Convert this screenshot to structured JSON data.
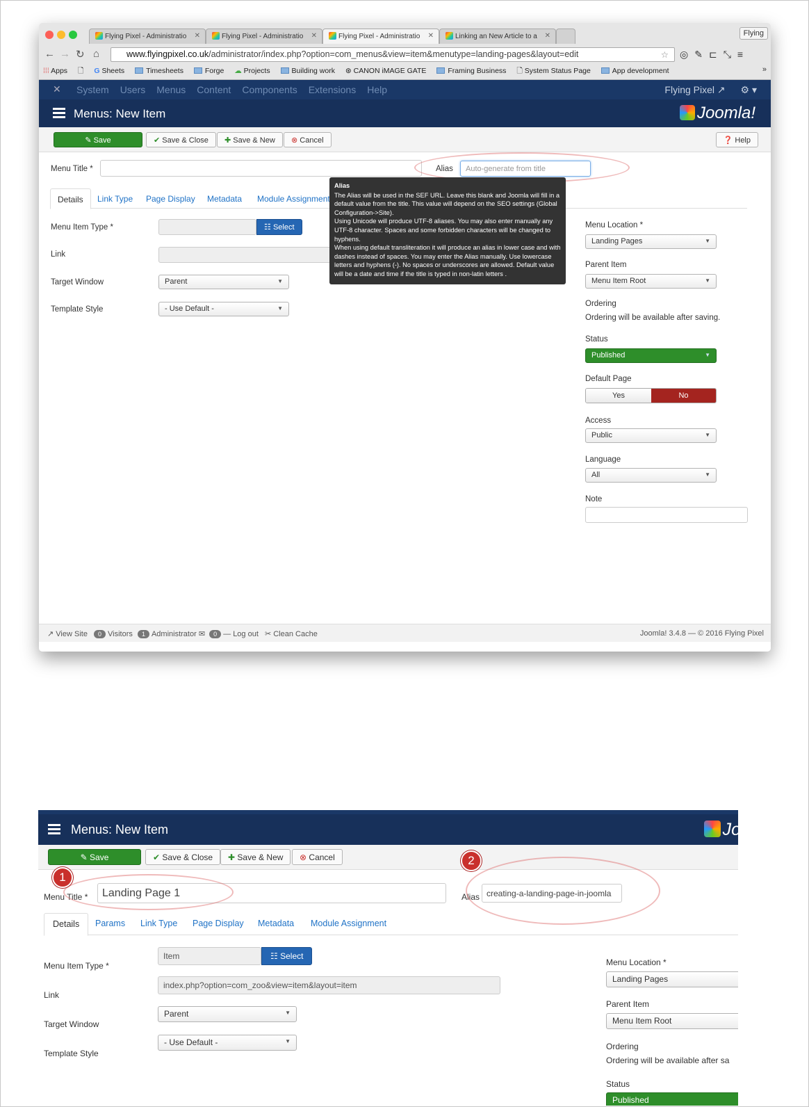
{
  "browser": {
    "tabs": [
      "Flying Pixel - Administratio",
      "Flying Pixel - Administratio",
      "Flying Pixel - Administratio",
      "Linking an New Article to a"
    ],
    "profile": "Flying",
    "url_domain": "www.flyingpixel.co.uk",
    "url_path": "/administrator/index.php?option=com_menus&view=item&menutype=landing-pages&layout=edit",
    "bookmarks": [
      "Apps",
      "Sheets",
      "Timesheets",
      "Forge",
      "Projects",
      "Building work",
      "CANON iMAGE GATE",
      "Framing Business",
      "System Status Page",
      "App development"
    ],
    "more": "»"
  },
  "topnav": {
    "items": [
      "System",
      "Users",
      "Menus",
      "Content",
      "Components",
      "Extensions",
      "Help"
    ],
    "site": "Flying Pixel"
  },
  "header": {
    "title": "Menus: New Item",
    "logo": "Joomla!"
  },
  "toolbar": {
    "save": "Save",
    "save_close": "Save & Close",
    "save_new": "Save & New",
    "cancel": "Cancel",
    "help": "Help"
  },
  "form": {
    "menu_title_label": "Menu Title *",
    "alias_label": "Alias",
    "alias_placeholder": "Auto-generate from title",
    "tabs": [
      "Details",
      "Link Type",
      "Page Display",
      "Metadata",
      "Module Assignment"
    ],
    "menu_item_type_label": "Menu Item Type *",
    "select_btn": "Select",
    "link_label": "Link",
    "target_window_label": "Target Window",
    "target_window_value": "Parent",
    "template_style_label": "Template Style",
    "template_style_value": "- Use Default -"
  },
  "tooltip": {
    "title": "Alias",
    "body": "The Alias will be used in the SEF URL. Leave this blank and Joomla will fill in a default value from the title. This value will depend on the SEO settings (Global Configuration->Site).",
    "body2": "Using Unicode will produce UTF-8 aliases. You may also enter manually any UTF-8 character. Spaces and some forbidden characters will be changed to hyphens.",
    "body3": "When using default transliteration it will produce an alias in lower case and with dashes instead of spaces. You may enter the Alias manually. Use lowercase letters and hyphens (-). No spaces or underscores are allowed. Default value will be a date and time if the title is typed in non-latin letters ."
  },
  "sidebar": {
    "menu_location_label": "Menu Location *",
    "menu_location_value": "Landing Pages",
    "parent_item_label": "Parent Item",
    "parent_item_value": "Menu Item Root",
    "ordering_label": "Ordering",
    "ordering_text": "Ordering will be available after saving.",
    "status_label": "Status",
    "status_value": "Published",
    "default_page_label": "Default Page",
    "yes": "Yes",
    "no": "No",
    "access_label": "Access",
    "access_value": "Public",
    "language_label": "Language",
    "language_value": "All",
    "note_label": "Note"
  },
  "footer": {
    "view_site": "View Site",
    "visitors_count": "0",
    "visitors": "Visitors",
    "admin_count": "1",
    "administrator": "Administrator",
    "messages_count": "0",
    "logout": "Log out",
    "clean_cache": "Clean Cache",
    "right": "Joomla! 3.4.8  —  © 2016 Flying Pixel"
  },
  "second": {
    "title": "Menus: New Item",
    "logo": "Jo",
    "menu_title_value": "Landing Page 1",
    "alias_value": "creating-a-landing-page-in-joomla",
    "tabs": [
      "Details",
      "Params",
      "Link Type",
      "Page Display",
      "Metadata",
      "Module Assignment"
    ],
    "menu_item_type_value": "Item",
    "link_value": "index.php?option=com_zoo&view=item&layout=item",
    "ordering_text": "Ordering will be available after sa",
    "callout1": "1",
    "callout2": "2"
  },
  "colors": {
    "nav_dark": "#17305a",
    "save_green": "#2e8e2a",
    "select_blue": "#2566b3",
    "no_red": "#a4241f",
    "link_blue": "#1f72c6",
    "callout_red": "#c9302c"
  }
}
